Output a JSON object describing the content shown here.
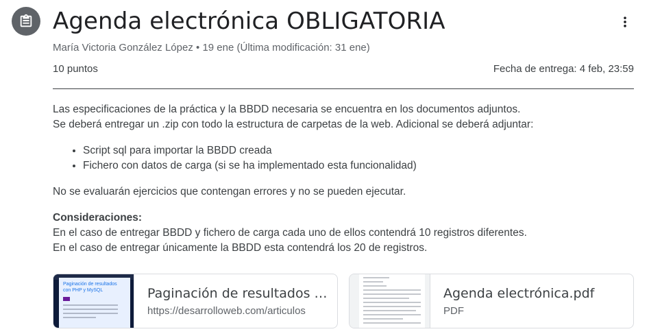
{
  "assignment": {
    "title": "Agenda electrónica OBLIGATORIA",
    "author": "María Victoria González López",
    "date": "19 ene",
    "modified": "(Última modificación: 31 ene)",
    "points": "10 puntos",
    "due": "Fecha de entrega: 4 feb, 23:59"
  },
  "description": {
    "line1": "Las especificaciones de la práctica y la BBDD necesaria se encuentra en los documentos adjuntos.",
    "line2": "Se deberá entregar un .zip con todo la estructura de carpetas de la web. Adicional se deberá adjuntar:",
    "bullets": [
      "Script sql para importar la BBDD creada",
      "Fichero con datos de carga (si se ha implementado esta funcionalidad)"
    ],
    "warning": "No se evaluarán ejercicios que contengan errores y no se pueden ejecutar.",
    "considerations_title": "Consideraciones:",
    "consideration1": "En el caso de entregar BBDD y fichero de carga cada uno de ellos contendrá 10 registros diferentes.",
    "consideration2": "En el caso de entregar únicamente la BBDD esta contendrá los 20 de registros."
  },
  "attachments": [
    {
      "title": "Paginación de resultados co...",
      "subtitle": "https://desarrolloweb.com/articulos",
      "thumb_text": "Paginación de resultados con PHP y MySQL"
    },
    {
      "title": "Agenda electrónica.pdf",
      "subtitle": "PDF"
    }
  ],
  "icons": {
    "avatar": "assignment-icon",
    "more": "more-vert-icon"
  },
  "colors": {
    "avatar_bg": "#5f6368",
    "text": "#3c4043",
    "secondary": "#5f6368",
    "border": "#dadce0"
  }
}
